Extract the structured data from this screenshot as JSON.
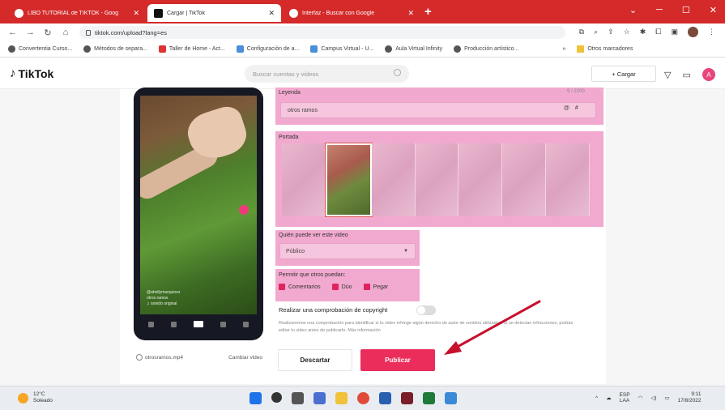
{
  "browser": {
    "tabs": [
      {
        "title": "LIBO TUTORIAL de TIKTOK - Goog",
        "active": false
      },
      {
        "title": "Cargar | TikTok",
        "active": true
      },
      {
        "title": "Interfaz - Buscar con Google",
        "active": false
      }
    ],
    "new_tab": "+",
    "url": "tiktok.com/upload?lang=es",
    "bookmarks": [
      "Convertentia Curso...",
      "Métodos de separa...",
      "Taller de Home - Act...",
      "Configuración de a...",
      "Campus Virtual - U...",
      "Aula Virtual Infinity",
      "Producción artístico...",
      "Otros marcadores"
    ],
    "bookmarks_more": "»"
  },
  "tiktok": {
    "logo": "TikTok",
    "search_placeholder": "Buscar cuentas y videos",
    "upload_label": "+ Cargar",
    "avatar_letter": "A"
  },
  "form": {
    "legend_label": "Leyenda",
    "legend_count": "9 / 2200",
    "legend_value": "otros ramos",
    "legend_tag_1": "@",
    "legend_tag_2": "#",
    "cover_label": "Portada",
    "privacy_label": "Quién puede ver este video",
    "privacy_value": "Público",
    "allow_label": "Permitir que otros puedan:",
    "allow_options": [
      "Comentarios",
      "Dúo",
      "Pegar"
    ],
    "copyright_label": "Realizar una comprobación de copyright",
    "copyright_desc": "Realizaremos una comprobación para identificar si tu video infringe algún derecho de autor de sonidos utilizados. Si se detectan infracciones, podrás editar tu video antes de publicarlo. Más información",
    "discard_label": "Descartar",
    "publish_label": "Publicar"
  },
  "phone": {
    "file_label": "otrosramos.mp4",
    "change_label": "Cambiar video",
    "caption_user": "@ahollymarquinez",
    "caption_text": "otros ramos",
    "caption_sound": "♫ sonido original"
  },
  "taskbar": {
    "temp": "12°C",
    "weather": "Soleado",
    "lang_1": "ESP",
    "lang_2": "LAA",
    "time": "9:11",
    "date": "17/8/2022"
  },
  "colors": {
    "tab_strip": "#d42a2a",
    "highlight_pink": "#f2a9cf",
    "publish": "#ea2d5a",
    "arrow": "#c8102e"
  }
}
